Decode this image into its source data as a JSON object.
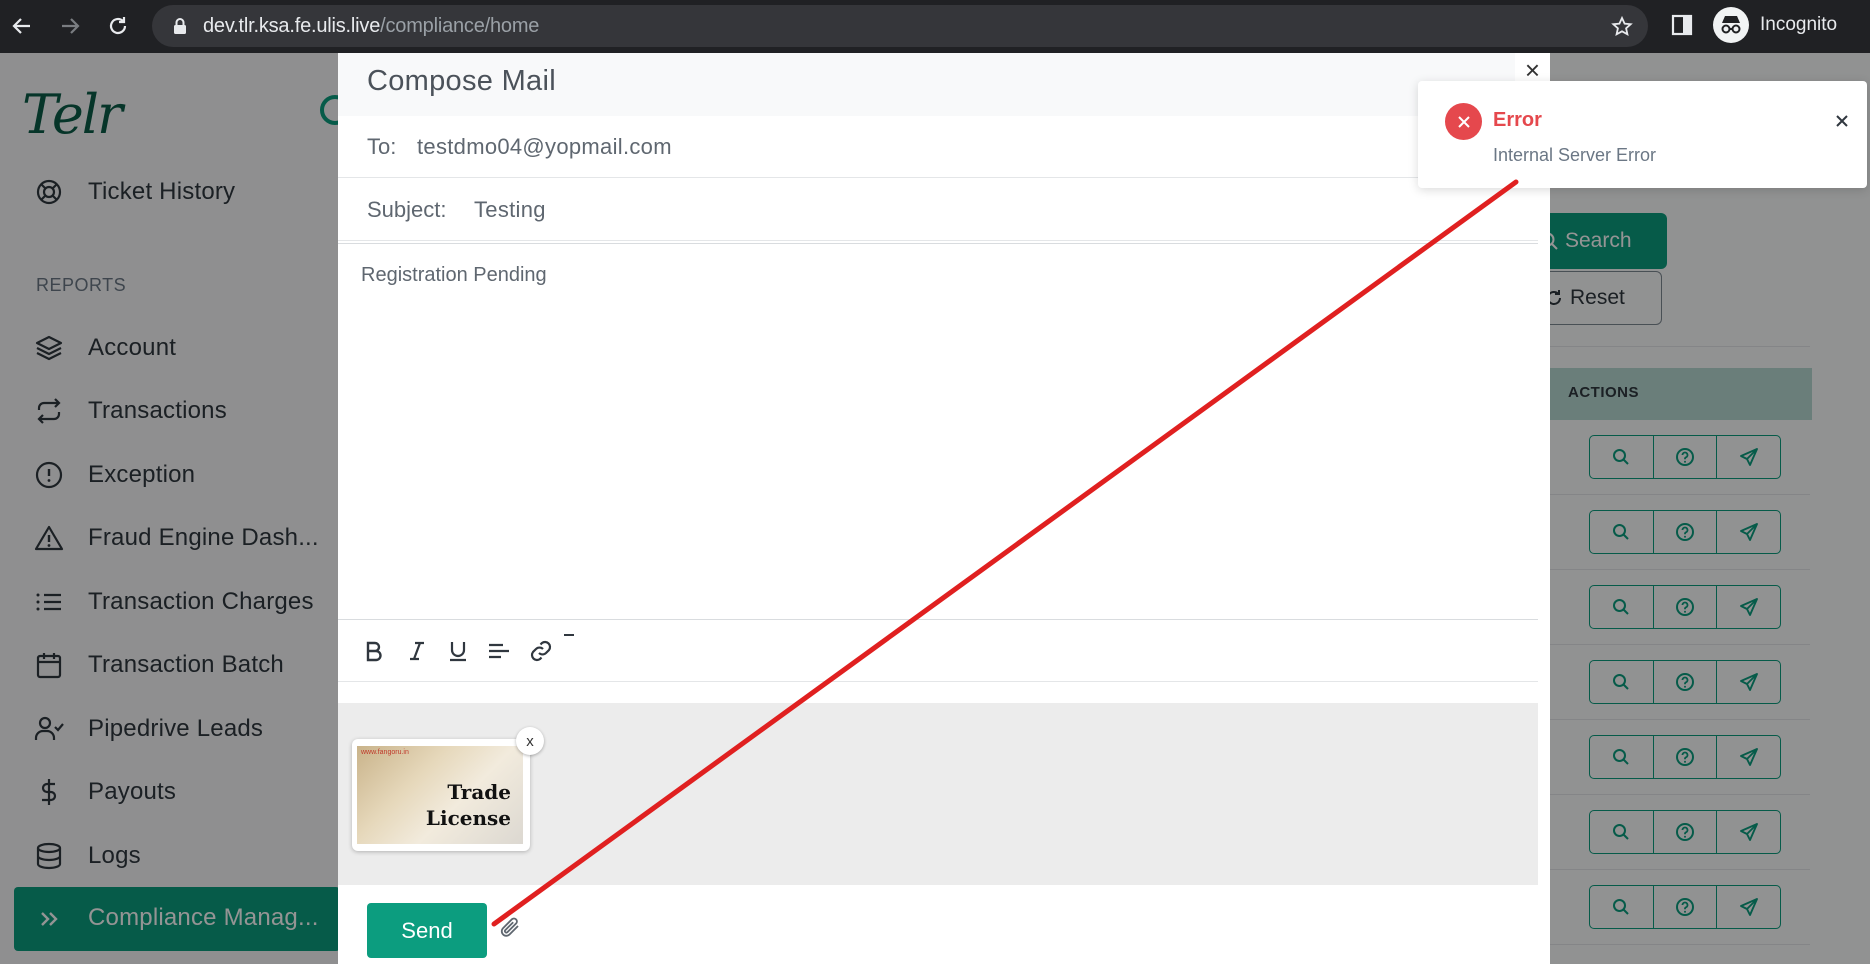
{
  "browser": {
    "url_host": "dev.tlr.ksa.fe.ulis.live",
    "url_path": "/compliance/home",
    "profile_label": "Incognito"
  },
  "sidebar": {
    "logo": "Telr",
    "section_label": "REPORTS",
    "items": [
      {
        "label": "Ticket History",
        "icon": "lifebuoy-icon"
      },
      {
        "label": "Account",
        "icon": "layers-icon"
      },
      {
        "label": "Transactions",
        "icon": "repeat-icon"
      },
      {
        "label": "Exception",
        "icon": "alert-circle-icon"
      },
      {
        "label": "Fraud Engine Dash...",
        "icon": "alert-triangle-icon"
      },
      {
        "label": "Transaction Charges",
        "icon": "list-icon"
      },
      {
        "label": "Transaction Batch",
        "icon": "calendar-icon"
      },
      {
        "label": "Pipedrive Leads",
        "icon": "user-check-icon"
      },
      {
        "label": "Payouts",
        "icon": "dollar-icon"
      },
      {
        "label": "Logs",
        "icon": "database-icon"
      },
      {
        "label": "Compliance Manag...",
        "icon": "chevrons-right-icon",
        "active": true
      }
    ]
  },
  "main": {
    "search_label": "Search",
    "reset_label": "Reset",
    "table_header_actions": "ACTIONS",
    "row_count": 7
  },
  "compose": {
    "title": "Compose Mail",
    "close_symbol": "×",
    "to_label": "To:",
    "to_value": "testdmo04@yopmail.com",
    "subject_label": "Subject:",
    "subject_value": "Testing",
    "body": "Registration Pending",
    "attachment": {
      "site_text": "www.fangoru.in",
      "line1": "Trade",
      "line2": "License",
      "remove_symbol": "x"
    },
    "send_label": "Send"
  },
  "toast": {
    "title": "Error",
    "message": "Internal Server Error",
    "color": "#e5484d"
  },
  "colors": {
    "accent": "#0c9d7f",
    "annotation_line": "#e02020"
  }
}
